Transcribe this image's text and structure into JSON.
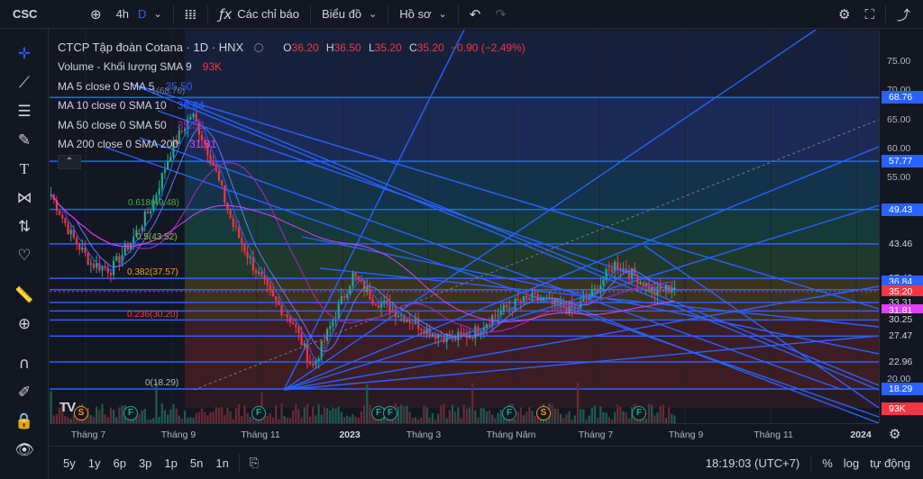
{
  "toolbar": {
    "symbol": "CSC",
    "interval": "4h",
    "interval_alt": "D",
    "indicators_label": "Các chỉ báo",
    "chart_type_label": "Biểu đồ",
    "profile_label": "Hồ sơ"
  },
  "legend": {
    "title": "CTCP Tập đoàn Cotana · 1D · HNX",
    "ohlc": {
      "o_label": "O",
      "o_value": "36.20",
      "h_label": "H",
      "h_value": "36.50",
      "l_label": "L",
      "l_value": "35.20",
      "c_label": "C",
      "c_value": "35.20",
      "change": "−0.90 (−2.49%)"
    },
    "volume": {
      "label": "Volume - Khối lượng SMA 9",
      "value": "93K"
    },
    "ma5": {
      "label": "MA 5 close 0 SMA 5",
      "value": "35.50"
    },
    "ma10": {
      "label": "MA 10 close 0 SMA 10",
      "value": "36.84"
    },
    "ma50": {
      "label": "MA 50 close 0 SMA 50",
      "value": "35.52"
    },
    "ma200": {
      "label": "MA 200 close 0 SMA 200",
      "value": "31.81"
    }
  },
  "colors": {
    "up": "#22ab94",
    "down": "#f23645",
    "line": "#2962ff",
    "ma5": "#2962ff",
    "ma10": "#2962ff",
    "ma50": "#9c27b0",
    "ma200": "#e040fb"
  },
  "fib_labels": [
    {
      "text": "0.618(49.48)",
      "price": 49.48,
      "color": "#4caf50"
    },
    {
      "text": "0.5(43.52)",
      "price": 43.52,
      "color": "#8bc34a"
    },
    {
      "text": "0.382(37.57)",
      "price": 37.57,
      "color": "#ff9800"
    },
    {
      "text": "0.236(30.20)",
      "price": 30.2,
      "color": "#f44336"
    },
    {
      "text": "0(18.29)",
      "price": 18.29,
      "color": "#b2b5be"
    },
    {
      "text": "1(68.76)",
      "price": 68.76,
      "color": "#787b86"
    }
  ],
  "price_axis": {
    "ticks": [
      "75.00",
      "70.00",
      "65.00",
      "60.00",
      "55.00",
      "20.00"
    ],
    "badges": [
      {
        "text": "68.76",
        "price": 68.76,
        "bg": "#2962ff"
      },
      {
        "text": "57.77",
        "price": 57.77,
        "bg": "#2962ff"
      },
      {
        "text": "49.43",
        "price": 49.43,
        "bg": "#2962ff"
      },
      {
        "text": "43.46",
        "price": 43.46,
        "bg": "#131722"
      },
      {
        "text": "37.48",
        "price": 37.48,
        "bg": "#131722"
      },
      {
        "text": "36.84",
        "price": 36.84,
        "bg": "#2962ff"
      },
      {
        "text": "35.52",
        "price": 35.52,
        "bg": "#9c27b0"
      },
      {
        "text": "35.50",
        "price": 35.5,
        "bg": "#2962ff"
      },
      {
        "text": "35.20",
        "price": 35.2,
        "bg": "#f23645"
      },
      {
        "text": "33.31",
        "price": 33.31,
        "bg": "#131722"
      },
      {
        "text": "31.81",
        "price": 31.81,
        "bg": "#e040fb"
      },
      {
        "text": "30.25",
        "price": 30.25,
        "bg": "#131722"
      },
      {
        "text": "27.47",
        "price": 27.47,
        "bg": "#131722"
      },
      {
        "text": "22.96",
        "price": 22.96,
        "bg": "#131722"
      },
      {
        "text": "18.29",
        "price": 18.29,
        "bg": "#2962ff"
      },
      {
        "text": "93K",
        "price": null,
        "bg": "#f23645"
      }
    ]
  },
  "time_axis": [
    {
      "label": "Tháng 7",
      "bold": false
    },
    {
      "label": "Tháng 9",
      "bold": false
    },
    {
      "label": "Tháng 11",
      "bold": false
    },
    {
      "label": "2023",
      "bold": true
    },
    {
      "label": "Tháng 3",
      "bold": false
    },
    {
      "label": "Tháng Năm",
      "bold": false
    },
    {
      "label": "Tháng 7",
      "bold": false
    },
    {
      "label": "Tháng 9",
      "bold": false
    },
    {
      "label": "Tháng 11",
      "bold": false
    },
    {
      "label": "2024",
      "bold": true
    }
  ],
  "bottom": {
    "ranges": [
      "5y",
      "1y",
      "6p",
      "3p",
      "1p",
      "5n",
      "1n"
    ],
    "clock": "18:19:03 (UTC+7)",
    "percent": "%",
    "log": "log",
    "auto": "tự động"
  },
  "events": [
    "S",
    "F",
    "F",
    "F",
    "F",
    "F",
    "S",
    "F"
  ],
  "chart_data": {
    "type": "candlestick",
    "ylim": [
      16,
      78
    ],
    "horizontal_lines": [
      68.76,
      57.77,
      49.43,
      43.46,
      37.48,
      35.5,
      33.31,
      31.81,
      30.25,
      27.47,
      22.96,
      18.29
    ],
    "fib_levels": [
      {
        "ratio": 1,
        "price": 68.76
      },
      {
        "ratio": 0.618,
        "price": 49.48
      },
      {
        "ratio": 0.5,
        "price": 43.52
      },
      {
        "ratio": 0.382,
        "price": 37.57
      },
      {
        "ratio": 0.236,
        "price": 30.2
      },
      {
        "ratio": 0,
        "price": 18.29
      }
    ],
    "last": {
      "open": 36.2,
      "high": 36.5,
      "low": 35.2,
      "close": 35.2
    },
    "price_path": [
      52,
      45,
      40,
      39,
      44,
      50,
      60,
      66,
      58,
      47,
      40,
      34,
      30,
      22,
      30,
      38,
      34,
      32,
      30,
      28,
      27,
      28,
      31,
      33,
      34,
      33,
      32,
      35,
      40,
      38,
      35,
      36
    ]
  }
}
